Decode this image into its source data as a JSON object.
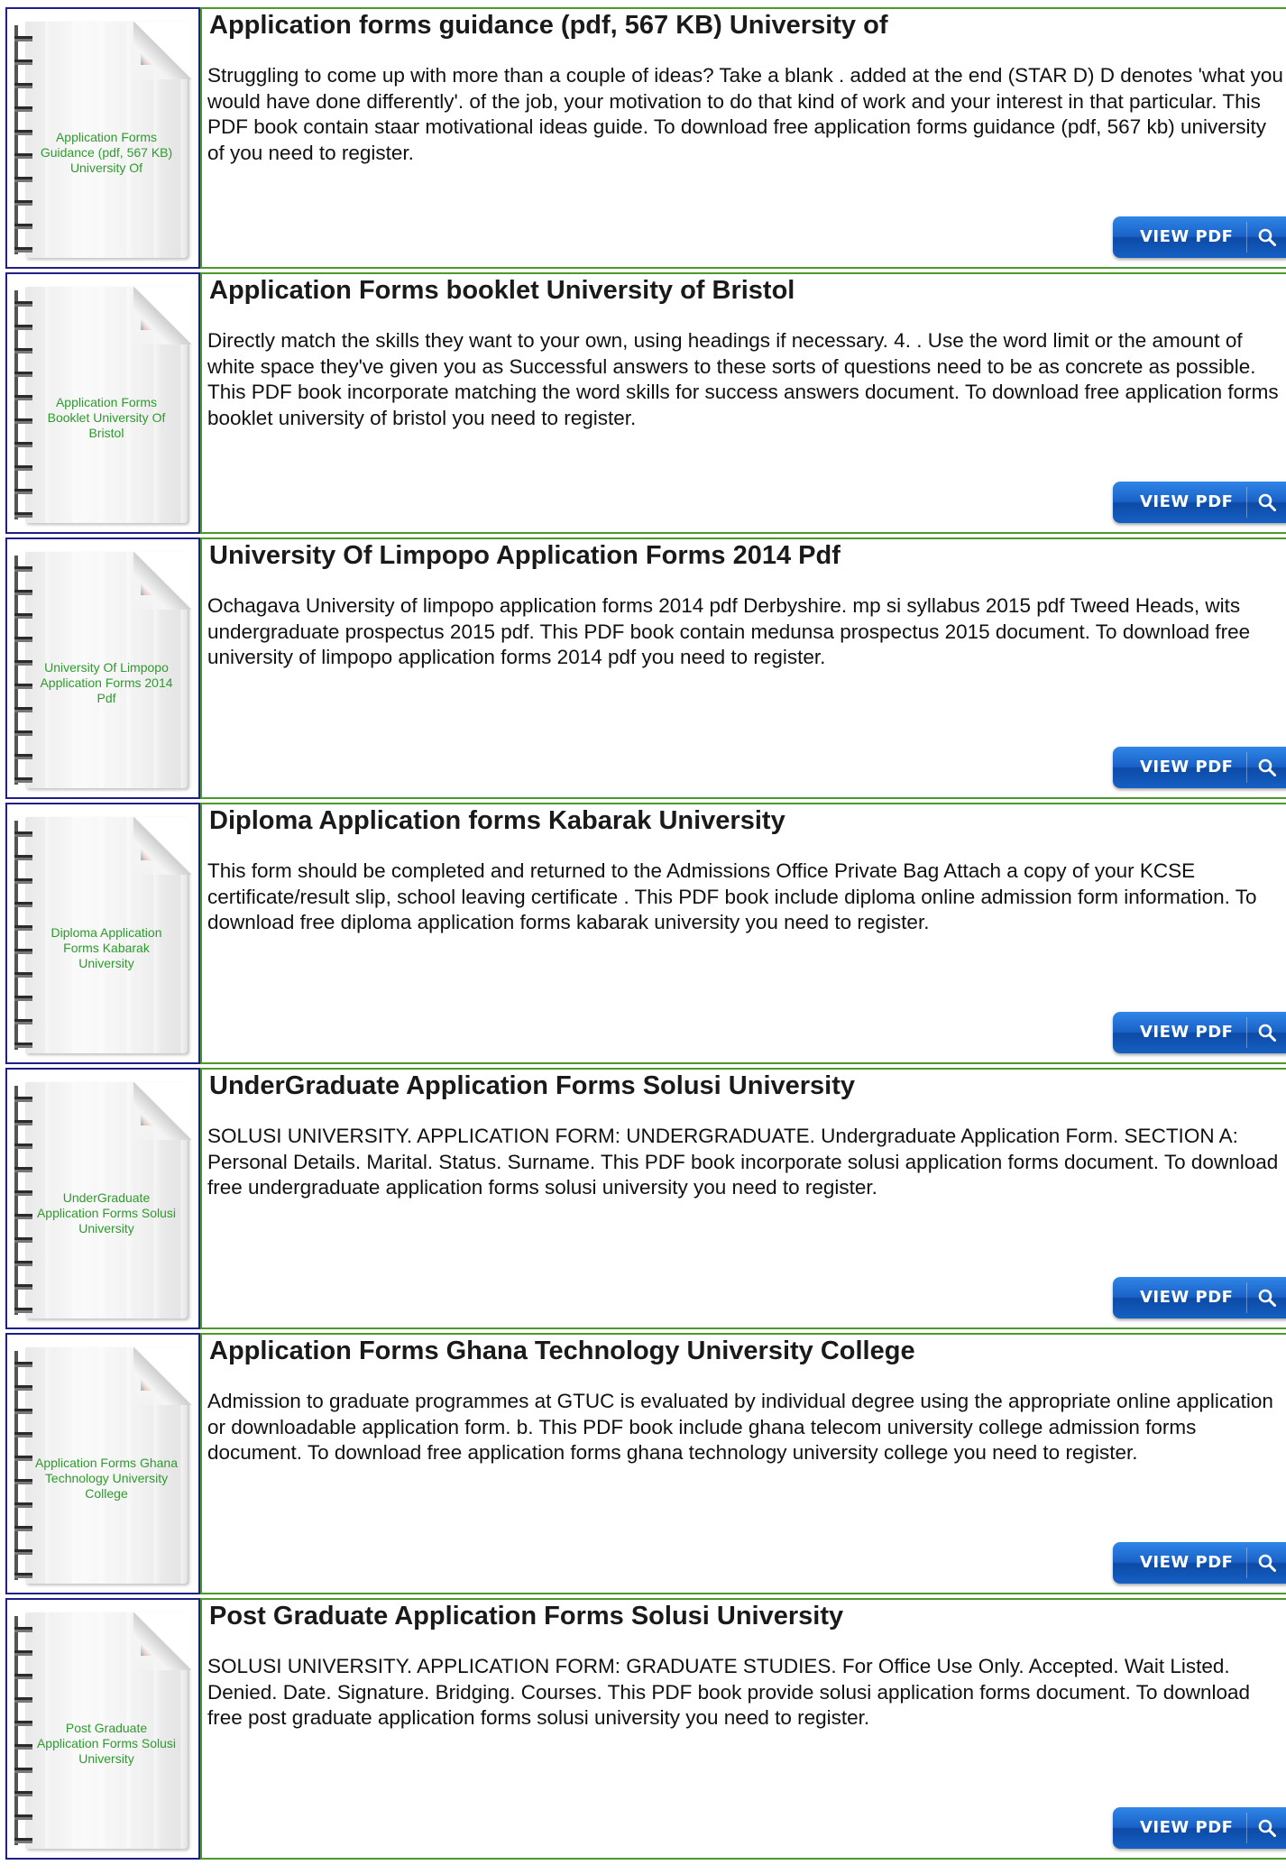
{
  "items": [
    {
      "title": "Application forms guidance (pdf, 567 KB) University of",
      "thumb_label": "Application Forms Guidance (pdf, 567 KB) University Of",
      "description": "Struggling to come up with more than a couple of ideas? Take a blank . added at the end (STAR D) D denotes 'what you would have done differently'. of the job, your motivation to do that kind of work and your interest in that particular. This PDF book contain staar motivational ideas guide. To download free application forms guidance (pdf, 567 kb) university of you need to register.",
      "button_label": "VIEW PDF"
    },
    {
      "title": "Application Forms booklet University of Bristol",
      "thumb_label": "Application Forms Booklet University Of Bristol",
      "description": "Directly match the skills they want to your own, using headings if necessary. 4. . Use the word limit or the amount of white space they've given you as Successful answers to these sorts of questions need to be as concrete as possible. This PDF book incorporate matching the word skills for success answers document. To download free application forms booklet university of bristol you need to register.",
      "button_label": "VIEW PDF"
    },
    {
      "title": "University Of Limpopo Application Forms 2014 Pdf",
      "thumb_label": "University Of Limpopo Application Forms 2014 Pdf",
      "description": "Ochagava University of limpopo application forms 2014 pdf Derbyshire. mp si syllabus 2015 pdf Tweed Heads, wits undergraduate prospectus 2015 pdf. This PDF book contain medunsa prospectus 2015 document. To download free university of limpopo application forms 2014 pdf you need to register.",
      "button_label": "VIEW PDF"
    },
    {
      "title": "Diploma Application forms Kabarak University",
      "thumb_label": "Diploma Application Forms Kabarak University",
      "description": "This form should be completed and returned to the Admissions Office Private Bag Attach a copy of your KCSE certificate/result slip, school leaving certificate . This PDF book include diploma online admission form information. To download free diploma application forms kabarak university you need to register.",
      "button_label": "VIEW PDF"
    },
    {
      "title": "UnderGraduate Application Forms Solusi University",
      "thumb_label": "UnderGraduate Application Forms Solusi University",
      "description": "SOLUSI UNIVERSITY. APPLICATION FORM: UNDERGRADUATE. Undergraduate Application Form. SECTION A: Personal Details. Marital. Status. Surname. This PDF book incorporate solusi application forms document. To download free undergraduate application forms solusi university you need to register.",
      "button_label": "VIEW PDF"
    },
    {
      "title": "Application Forms Ghana Technology University College",
      "thumb_label": "Application Forms Ghana Technology University College",
      "description": "Admission to graduate programmes at GTUC is evaluated by individual degree using the appropriate online application or downloadable application form. b. This PDF book include ghana telecom university college admission forms document. To download free application forms ghana technology university college you need to register.",
      "button_label": "VIEW PDF"
    },
    {
      "title": "Post Graduate Application Forms Solusi University",
      "thumb_label": "Post Graduate Application Forms Solusi University",
      "description": "SOLUSI UNIVERSITY. APPLICATION FORM: GRADUATE STUDIES. For Office Use Only. Accepted. Wait Listed. Denied. Date. Signature. Bridging. Courses. This PDF book provide solusi application forms document. To download free post graduate application forms solusi university you need to register.",
      "button_label": "VIEW PDF"
    }
  ],
  "colors": {
    "thumb_border": "#1f1f87",
    "content_border": "#4a9a2a",
    "thumb_label": "#2e9a2e",
    "button": "#1a62c8"
  },
  "icons": {
    "button_icon": "search-icon",
    "cover_logo": "book-cover-logo-icon"
  }
}
